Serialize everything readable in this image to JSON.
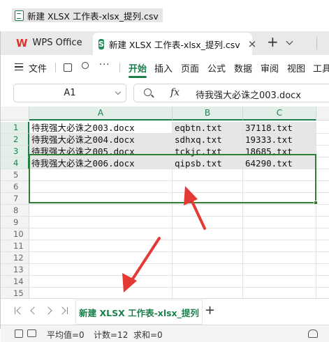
{
  "title_strip": {
    "filename": "新建 XLSX 工作表-xlsx_提列.csv"
  },
  "tabs": {
    "wps": {
      "label": "WPS Office"
    },
    "file": {
      "label": "新建 XLSX 工作表-xlsx_提列.csv",
      "close": "×"
    },
    "new_tab": "+"
  },
  "menu": {
    "file": "文件",
    "more": "···",
    "items": [
      "开始",
      "插入",
      "页面",
      "公式",
      "数据",
      "审阅",
      "视图",
      "工具"
    ],
    "active": "开始"
  },
  "formula_bar": {
    "name_box": "A1",
    "fx": "fx",
    "content": "待我强大必诛之003.docx"
  },
  "grid": {
    "columns": [
      "A",
      "B",
      "C"
    ],
    "rows": [
      "1",
      "2",
      "3",
      "4",
      "5",
      "6",
      "7",
      "8",
      "9",
      "10",
      "11",
      "12",
      "13",
      "14",
      "15"
    ],
    "cells": [
      [
        "待我强大必诛之003.docx",
        "eqbtn.txt",
        "37118.txt"
      ],
      [
        "待我强大必诛之004.docx",
        "sdhxq.txt",
        "19333.txt"
      ],
      [
        "待我强大必诛之005.docx",
        "tckjc.txt",
        "18685.txt"
      ],
      [
        "待我强大必诛之006.docx",
        "qipsb.txt",
        "64290.txt"
      ]
    ]
  },
  "sheet": {
    "tab": "新建 XLSX 工作表-xlsx_提列",
    "add": "+"
  },
  "status": {
    "average": "平均值=0",
    "count": "计数=12",
    "sum": "求和=0"
  },
  "colors": {
    "accent": "#1a7f4b",
    "selection": "#2e7d32",
    "arrow": "#e53935"
  }
}
